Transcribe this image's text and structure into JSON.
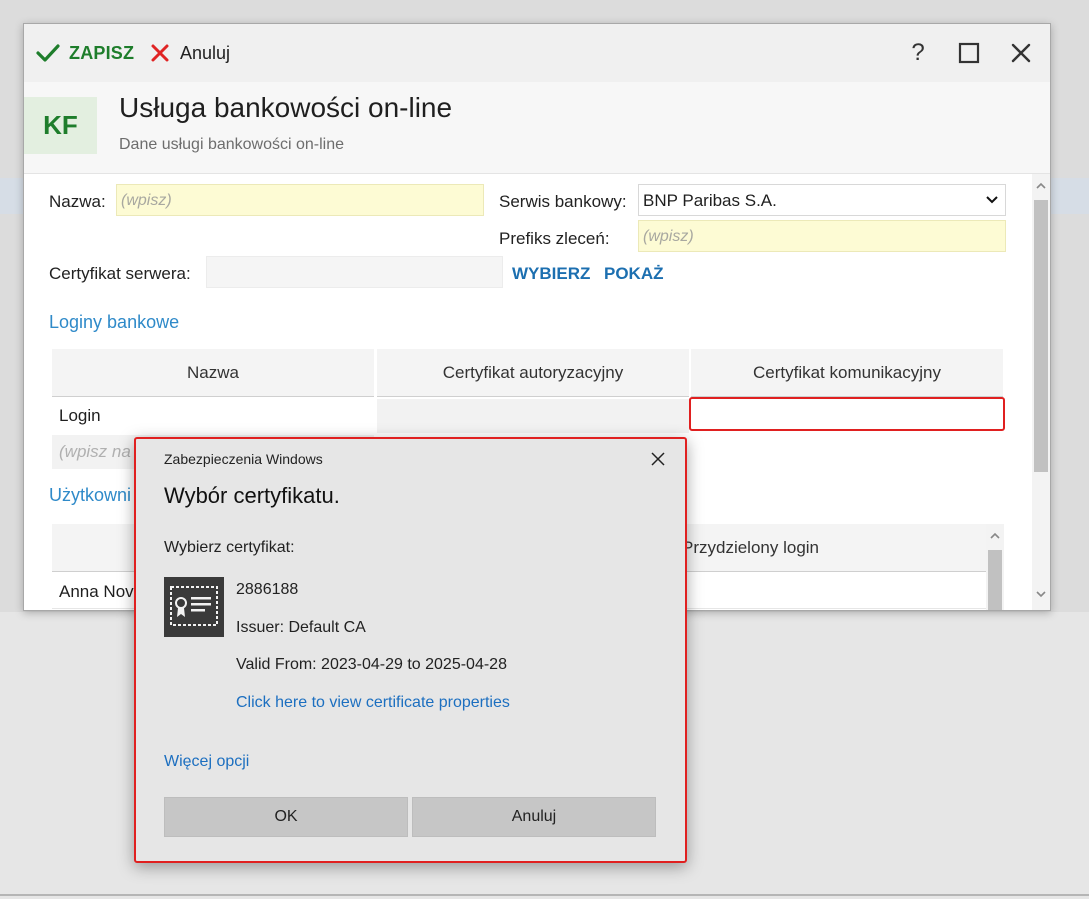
{
  "toolbar": {
    "save_label": "ZAPISZ",
    "cancel_label": "Anuluj",
    "help_label": "?"
  },
  "header": {
    "badge": "KF",
    "title": "Usługa bankowości on-line",
    "subtitle": "Dane usługi bankowości on-line"
  },
  "form": {
    "name_label": "Nazwa:",
    "name_placeholder": "(wpisz)",
    "bank_service_label": "Serwis bankowy:",
    "bank_service_value": "BNP Paribas S.A.",
    "order_prefix_label": "Prefiks zleceń:",
    "order_prefix_placeholder": "(wpisz)",
    "server_cert_label": "Certyfikat serwera:",
    "choose_link": "WYBIERZ",
    "show_link": "POKAŻ"
  },
  "bank_logins": {
    "section_title": "Loginy bankowe",
    "columns": [
      "Nazwa",
      "Certyfikat autoryzacyjny",
      "Certyfikat komunikacyjny"
    ],
    "rows": [
      {
        "name": "Login",
        "auth_cert": "",
        "comm_cert": ""
      }
    ],
    "new_row_placeholder": "(wpisz na"
  },
  "users": {
    "section_title": "Użytkowni",
    "assigned_login_header": "Przydzielony login",
    "first_row_name": "Anna Nov"
  },
  "dialog": {
    "caption": "Zabezpieczenia Windows",
    "title": "Wybór certyfikatu.",
    "prompt": "Wybierz certyfikat:",
    "cert_id": "2886188",
    "issuer": "Issuer: Default CA",
    "validity": "Valid From: 2023-04-29 to 2025-04-28",
    "properties_link": "Click here to view certificate properties",
    "more_options_link": "Więcej opcji",
    "ok_label": "OK",
    "cancel_label": "Anuluj"
  },
  "colors": {
    "accent_green": "#1e7d2b",
    "link_blue": "#1c6fb0",
    "highlight_red": "#e02020",
    "field_yellow": "#fdfbd4"
  }
}
